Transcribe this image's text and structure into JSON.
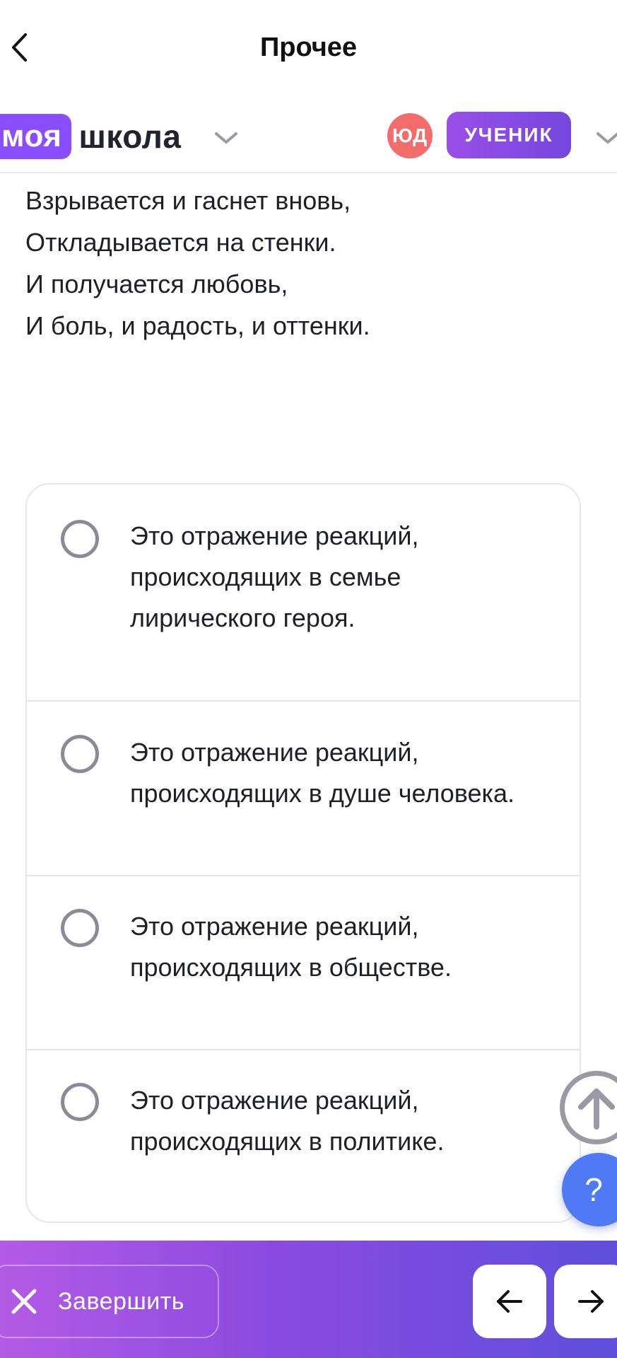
{
  "header": {
    "title": "Прочее"
  },
  "appbar": {
    "logo_part1": "моя",
    "logo_part2": "школа",
    "avatar_initials": "ЮД",
    "role_label": "УЧЕНИК"
  },
  "poem": {
    "lines": [
      "Взрывается и гаснет вновь,",
      "Откладывается на стенки.",
      "И получается любовь,",
      "И боль, и радость, и оттенки."
    ]
  },
  "options": [
    {
      "lines": [
        "Это отражение реакций,",
        "происходящих в семье",
        "лирического героя."
      ]
    },
    {
      "lines": [
        "Это отражение реакций,",
        "происходящих в душе человека."
      ]
    },
    {
      "lines": [
        "Это отражение реакций,",
        "происходящих в обществе."
      ]
    },
    {
      "lines": [
        "Это отражение реакций,",
        "происходящих в политике."
      ]
    }
  ],
  "floating": {
    "help_label": "?"
  },
  "footer": {
    "finish_label": "Завершить"
  },
  "icons": {
    "back": "chevron-left-icon",
    "dropdown": "chevron-down-icon",
    "scroll_up": "arrow-up-icon",
    "help": "question-icon",
    "finish": "close-icon",
    "prev": "arrow-left-icon",
    "next": "arrow-right-icon"
  },
  "colors": {
    "logo_accent": "#8a4dff",
    "avatar": "#f46d6d",
    "role_badge": "#8a4adf",
    "help_button": "#4f79f5",
    "footer_gradient_start": "#b35be6",
    "footer_gradient_end": "#5f4fdc"
  }
}
